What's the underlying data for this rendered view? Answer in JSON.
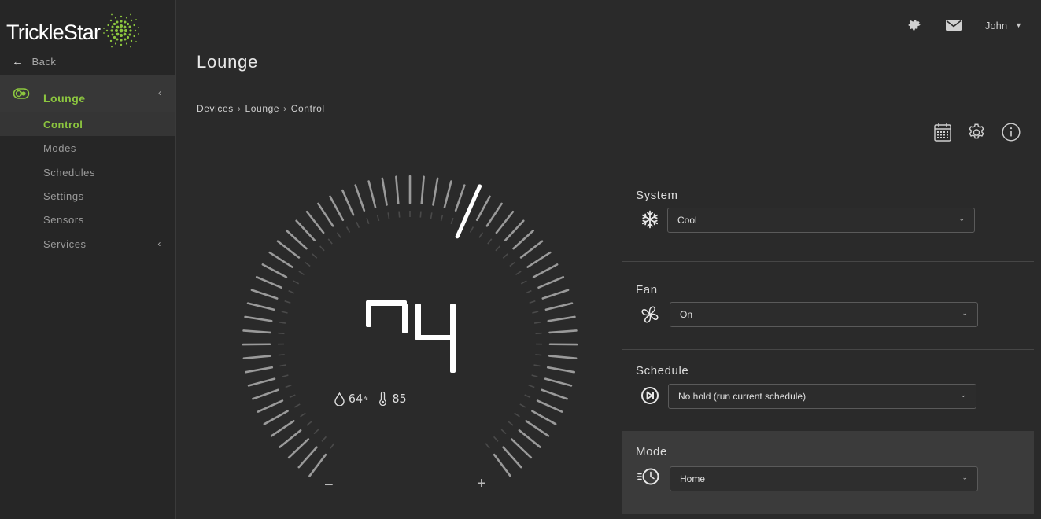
{
  "brand": {
    "name": "TrickleStar",
    "accent": "#8cc63f"
  },
  "topbar": {
    "icons": [
      "gear-icon",
      "mail-icon"
    ],
    "user": "John"
  },
  "sidebar": {
    "back_label": "Back",
    "group": {
      "label": "Lounge",
      "icon": "device-toggle-icon"
    },
    "items": [
      {
        "label": "Control",
        "active": true
      },
      {
        "label": "Modes"
      },
      {
        "label": "Schedules"
      },
      {
        "label": "Settings"
      },
      {
        "label": "Sensors"
      },
      {
        "label": "Services",
        "expandable": true
      }
    ]
  },
  "page": {
    "title": "Lounge",
    "breadcrumb": [
      "Devices",
      "Lounge",
      "Control"
    ],
    "tool_icons": [
      "calendar-icon",
      "settings-icon",
      "info-icon"
    ]
  },
  "thermostat": {
    "setpoint": "74",
    "humidity": "64",
    "humidity_unit": "%",
    "outdoor_temp": "85",
    "minus_label": "−",
    "plus_label": "+"
  },
  "controls": {
    "system": {
      "label": "System",
      "value": "Cool",
      "icon": "snowflake-icon"
    },
    "fan": {
      "label": "Fan",
      "value": "On",
      "icon": "fan-icon"
    },
    "schedule": {
      "label": "Schedule",
      "value": "No hold (run current schedule)",
      "icon": "skip-icon"
    },
    "mode": {
      "label": "Mode",
      "value": "Home",
      "icon": "mode-clock-icon"
    }
  }
}
